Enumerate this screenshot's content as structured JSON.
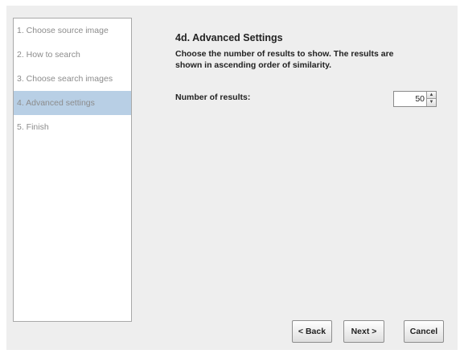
{
  "wizard": {
    "steps": [
      {
        "label": "1. Choose source image",
        "active": false
      },
      {
        "label": "2. How to search",
        "active": false
      },
      {
        "label": "3. Choose search images",
        "active": false
      },
      {
        "label": "4. Advanced settings",
        "active": true
      },
      {
        "label": "5. Finish",
        "active": false
      }
    ],
    "heading": "4d. Advanced Settings",
    "description": "Choose the number of results to show. The results are shown in ascending order of similarity.",
    "field_label": "Number of results:",
    "results_value": "50",
    "buttons": {
      "back": "< Back",
      "next": "Next >",
      "cancel": "Cancel"
    }
  },
  "colors": {
    "panel_bg": "#eeeeee",
    "list_bg": "#ffffff",
    "active_step_bg": "#b8cfe5",
    "step_text": "#8c8c8c",
    "text": "#222222"
  }
}
